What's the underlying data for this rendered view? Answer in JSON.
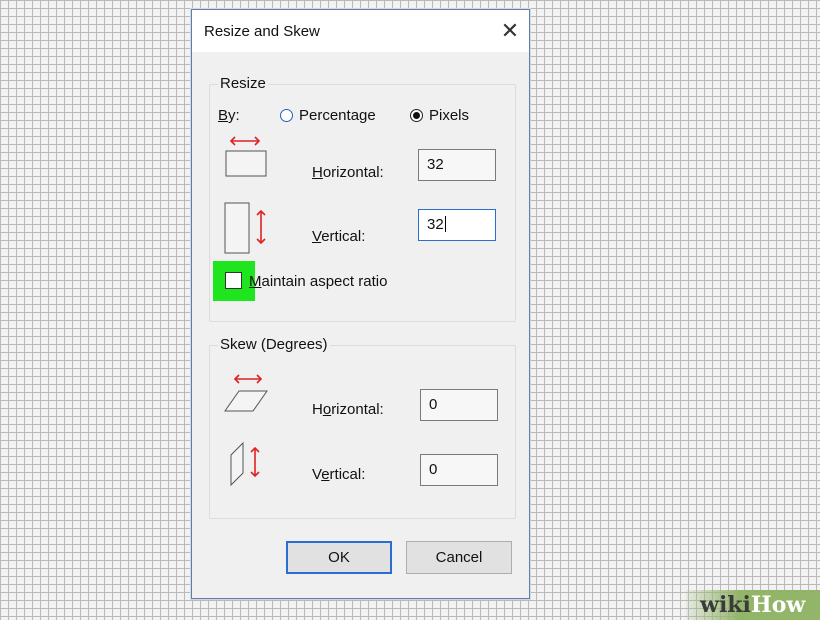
{
  "dialog": {
    "title": "Resize and Skew",
    "close_glyph": "✕"
  },
  "resize": {
    "group_label": "Resize",
    "by_label_pre": "",
    "by_label_u": "B",
    "by_label_post": "y:",
    "percentage_label": "Percentage",
    "pixels_label": "Pixels",
    "selected_unit": "Pixels",
    "horizontal_label_u": "H",
    "horizontal_label_post": "orizontal:",
    "horizontal_value": "32",
    "vertical_label_u": "V",
    "vertical_label_post": "ertical:",
    "vertical_value": "32",
    "aspect_label_u": "M",
    "aspect_label_post": "aintain aspect ratio",
    "aspect_checked": false
  },
  "skew": {
    "group_label": "Skew (Degrees)",
    "horizontal_label_pre": "H",
    "horizontal_label_u": "o",
    "horizontal_label_post": "rizontal:",
    "horizontal_value": "0",
    "vertical_label_pre": "V",
    "vertical_label_u": "e",
    "vertical_label_post": "rtical:",
    "vertical_value": "0"
  },
  "buttons": {
    "ok": "OK",
    "cancel": "Cancel"
  },
  "watermark": {
    "part1": "wiki",
    "part2": "How"
  },
  "colors": {
    "highlight": "#1ee51e",
    "arrow_red": "#e02020",
    "focus_blue": "#2a6ed0"
  },
  "icons": [
    "resize-horizontal-icon",
    "resize-vertical-icon",
    "skew-horizontal-icon",
    "skew-vertical-icon"
  ]
}
